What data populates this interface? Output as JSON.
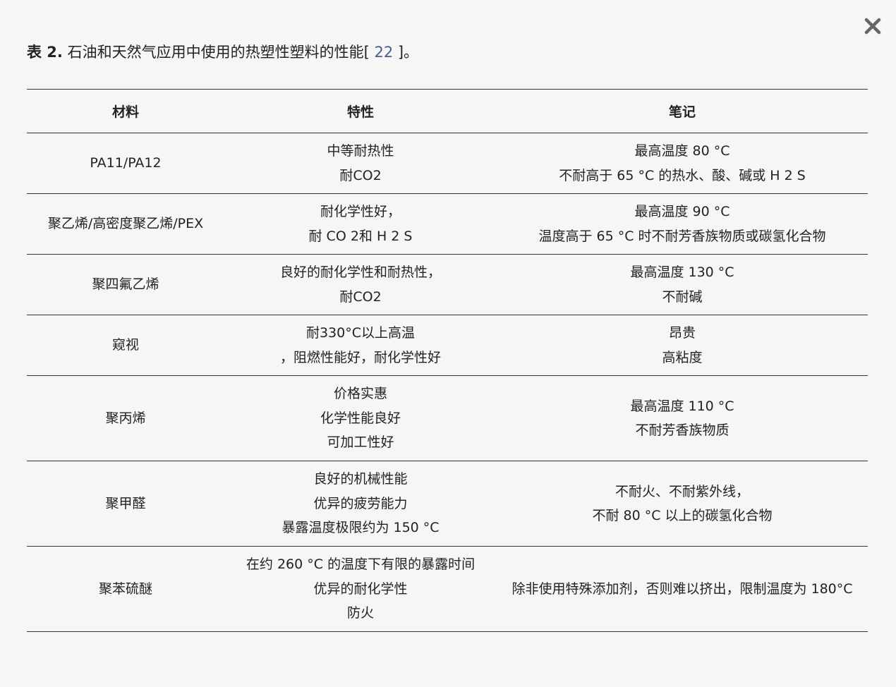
{
  "caption": {
    "label": "表 2.",
    "text": " 石油和天然气应用中使用的热塑性塑料的性能[ ",
    "ref": "22",
    "end": " ]。"
  },
  "close_icon": "close-icon",
  "table": {
    "headers": [
      "材料",
      "特性",
      "笔记"
    ],
    "rows": [
      {
        "material": "PA11/PA12",
        "properties": [
          "中等耐热性",
          "耐CO2"
        ],
        "notes": [
          "最高温度 80 °C",
          "不耐高于 65 °C 的热水、酸、碱或 H 2 S"
        ]
      },
      {
        "material": "聚乙烯/高密度聚乙烯/PEX",
        "properties": [
          "耐化学性好，",
          "耐 CO 2和 H 2 S"
        ],
        "notes": [
          "最高温度 90 °C",
          "温度高于 65 °C 时不耐芳香族物质或碳氢化合物"
        ]
      },
      {
        "material": "聚四氟乙烯",
        "properties": [
          "良好的耐化学性和耐热性，",
          "耐CO2"
        ],
        "notes": [
          "最高温度 130 °C",
          "不耐碱"
        ]
      },
      {
        "material": "窥视",
        "properties": [
          "耐330°C以上高温",
          "，阻燃性能好，耐化学性好"
        ],
        "notes": [
          "昂贵",
          "高粘度"
        ]
      },
      {
        "material": "聚丙烯",
        "properties": [
          "价格实惠",
          "化学性能良好",
          "可加工性好"
        ],
        "notes": [
          "最高温度 110 °C",
          "不耐芳香族物质"
        ]
      },
      {
        "material": "聚甲醛",
        "properties": [
          "良好的机械性能",
          "优异的疲劳能力",
          "暴露温度极限约为 150 °C"
        ],
        "notes": [
          "不耐火、不耐紫外线，",
          "不耐 80 °C 以上的碳氢化合物"
        ]
      },
      {
        "material": "聚苯硫醚",
        "properties": [
          "在约 260 °C 的温度下有限的暴露时间",
          "优异的耐化学性",
          "防火"
        ],
        "notes": [
          "除非使用特殊添加剂，否则难以挤出，限制温度为 180°C"
        ]
      }
    ]
  }
}
